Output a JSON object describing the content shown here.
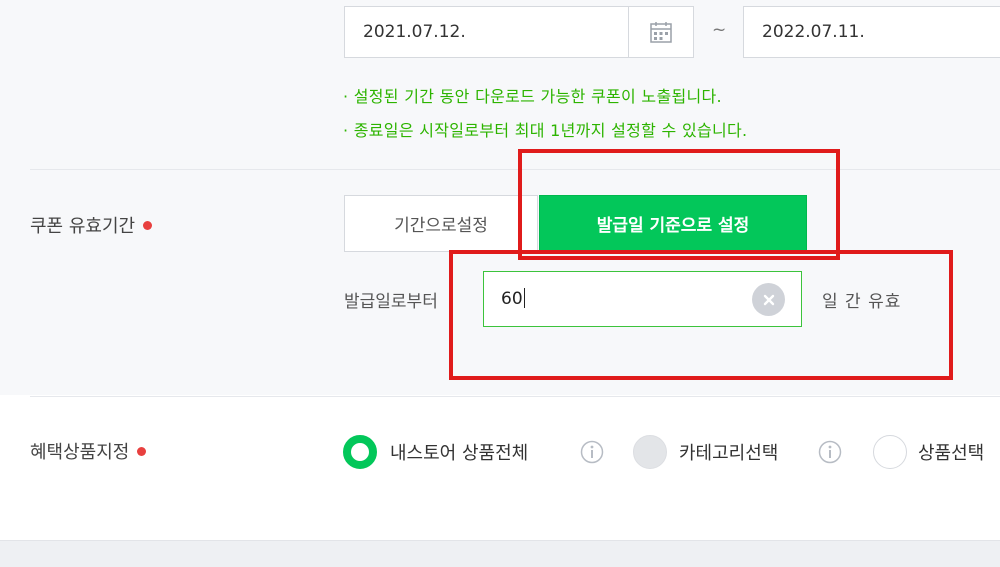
{
  "period": {
    "start_date": "2021.07.12.",
    "end_date": "2022.07.11.",
    "separator": "~",
    "hints": [
      "· 설정된 기간 동안 다운로드 가능한 쿠폰이 노출됩니다.",
      "· 종료일은 시작일로부터 최대 1년까지 설정할 수 있습니다."
    ]
  },
  "validity": {
    "label": "쿠폰 유효기간",
    "options": [
      "기간으로설정",
      "발급일 기준으로 설정"
    ],
    "selected": "발급일 기준으로 설정",
    "days_prefix": "발급일로부터",
    "days_value": "60",
    "days_suffix": "일 간 유효"
  },
  "benefit": {
    "label": "혜택상품지정",
    "options": [
      "내스토어 상품전체",
      "카테고리선택",
      "상품선택"
    ],
    "selected": "내스토어 상품전체"
  },
  "colors": {
    "accent": "#03c75a",
    "hint": "#2db400",
    "required_dot": "#e8403f",
    "annotation": "#e01b1b"
  },
  "icons": [
    "calendar-icon",
    "clear-icon",
    "info-icon"
  ]
}
